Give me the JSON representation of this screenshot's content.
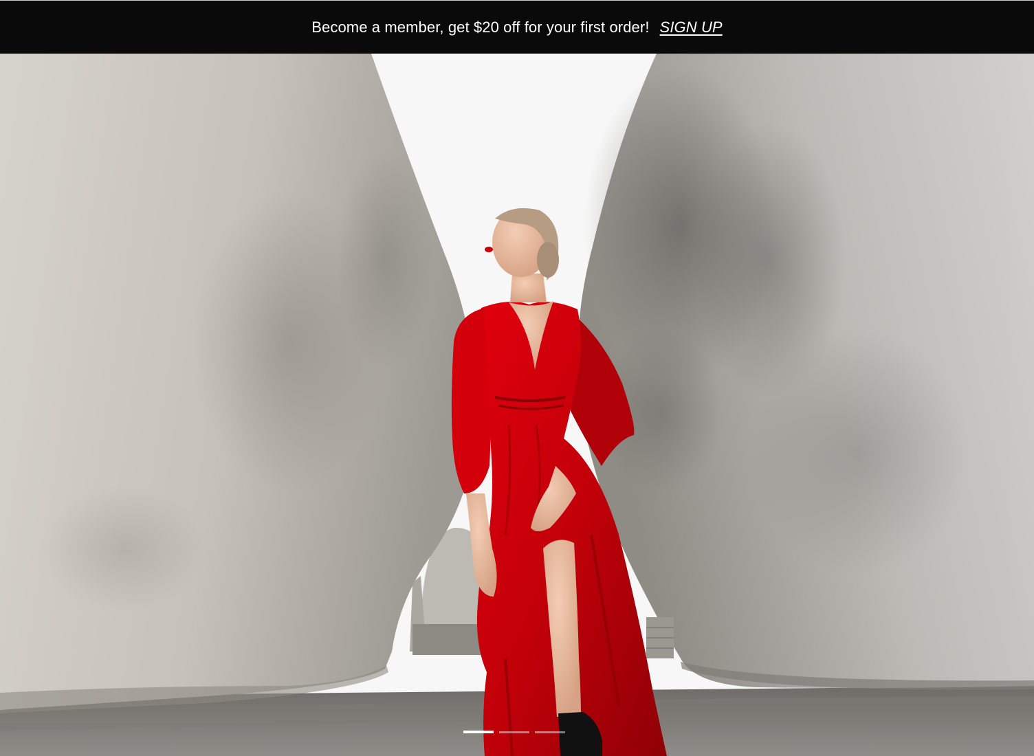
{
  "promo": {
    "text": "Become a member, get $20 off for your first order!",
    "link_label": "SIGN UP"
  },
  "hero": {
    "slide_count": 3,
    "active_slide": 1,
    "colors": {
      "dress": "#c8000a",
      "concrete": "#c9c5bd",
      "sky": "#f6f7f6",
      "promo_bg": "#0a0a0a"
    }
  }
}
